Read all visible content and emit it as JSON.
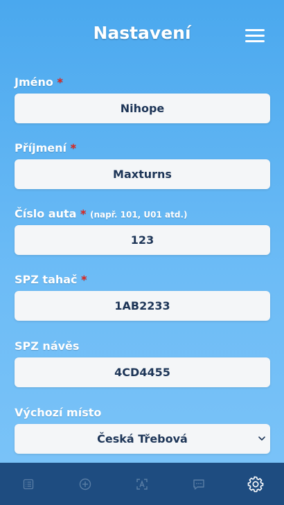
{
  "header": {
    "title": "Nastavení"
  },
  "form": {
    "first_name": {
      "label": "Jméno",
      "required_mark": "*",
      "value": "Nihope"
    },
    "last_name": {
      "label": "Příjmení",
      "required_mark": "*",
      "value": "Maxturns"
    },
    "car_number": {
      "label": "Číslo auta",
      "required_mark": "*",
      "hint": "(např. 101, U01 atd.)",
      "value": "123"
    },
    "truck_plate": {
      "label": "SPZ tahač",
      "required_mark": "*",
      "value": "1AB2233"
    },
    "trailer_plate": {
      "label": "SPZ návěs",
      "value": "4CD4455"
    },
    "start_place": {
      "label": "Výchozí místo",
      "value": "Česká Třebová"
    }
  },
  "bottom_nav": {
    "items": [
      {
        "icon": "list-icon",
        "active": false
      },
      {
        "icon": "add-circle-icon",
        "active": false
      },
      {
        "icon": "scan-icon",
        "active": false
      },
      {
        "icon": "chat-icon",
        "active": false
      },
      {
        "icon": "gear-icon",
        "active": true
      }
    ]
  },
  "colors": {
    "background_top": "#4aa8ee",
    "background_bottom": "#7cc4f8",
    "nav_background": "#1e4c80",
    "required": "#e2231a",
    "field_text": "#1d3557"
  }
}
